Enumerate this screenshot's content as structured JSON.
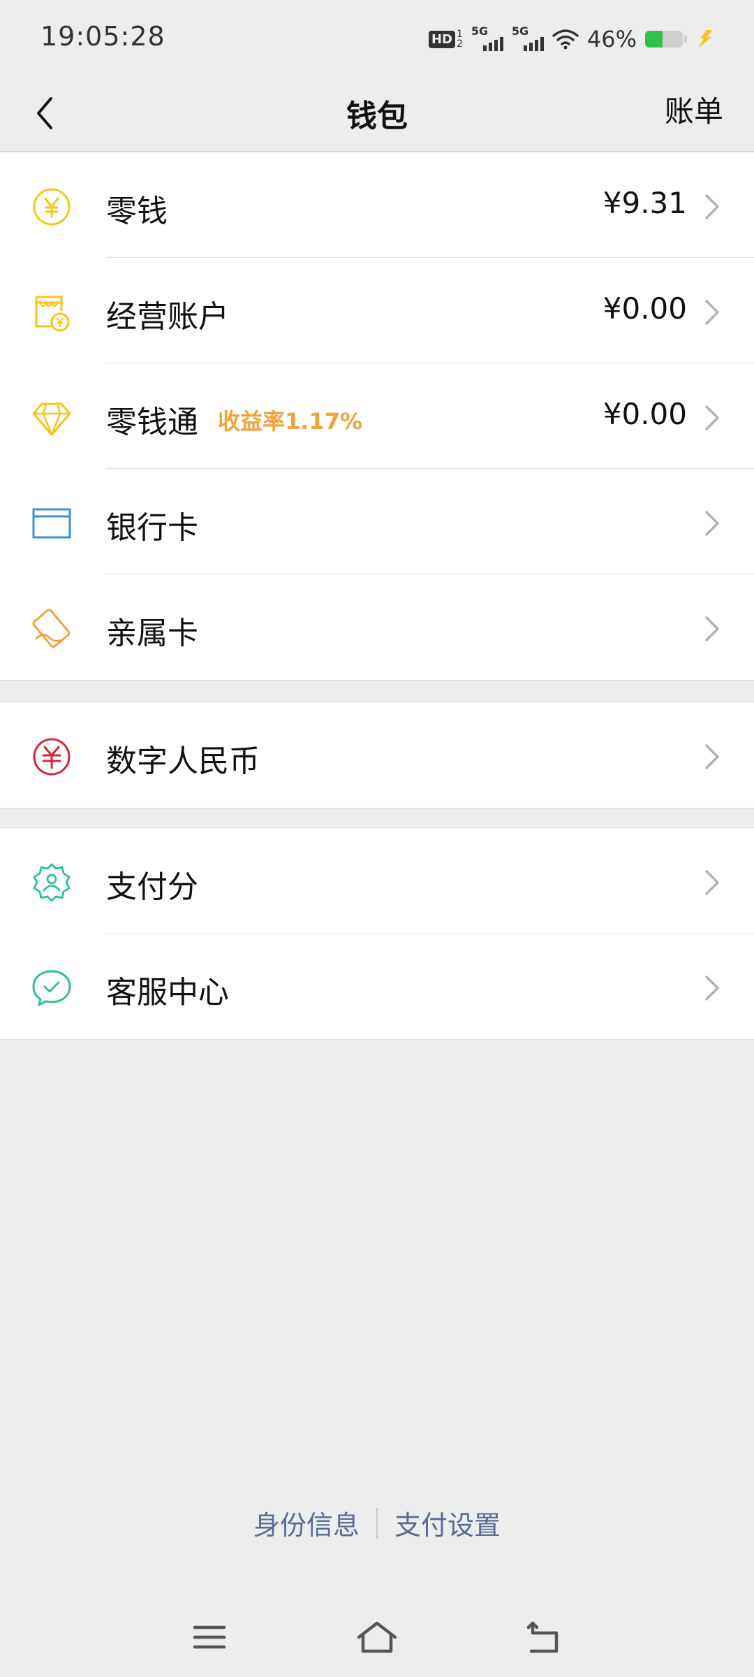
{
  "status_bar": {
    "time": "19:05:28",
    "hd_label": "HD",
    "hd_top": "1",
    "hd_bottom": "2",
    "sim1_label": "5G",
    "sim2_label": "5G",
    "battery_percent": "46%",
    "battery_level": 0.46
  },
  "header": {
    "title": "钱包",
    "action": "账单"
  },
  "groups": [
    {
      "items": [
        {
          "label": "零钱",
          "value": "¥9.31",
          "icon": "yuan-coin-icon",
          "color": "#f5c518"
        },
        {
          "label": "经营账户",
          "value": "¥0.00",
          "icon": "shop-account-icon",
          "color": "#f5c518"
        },
        {
          "label": "零钱通",
          "badge": "收益率1.17%",
          "value": "¥0.00",
          "icon": "diamond-icon",
          "color": "#f5c518"
        },
        {
          "label": "银行卡",
          "icon": "bank-card-icon",
          "color": "#3d8fd9"
        },
        {
          "label": "亲属卡",
          "icon": "family-card-icon",
          "color": "#f0a33a"
        }
      ]
    },
    {
      "items": [
        {
          "label": "数字人民币",
          "icon": "digital-rmb-icon",
          "color": "#d8243c"
        }
      ]
    },
    {
      "items": [
        {
          "label": "支付分",
          "icon": "pay-score-icon",
          "color": "#2fc289"
        },
        {
          "label": "客服中心",
          "icon": "customer-service-icon",
          "color": "#2fc289"
        }
      ]
    }
  ],
  "footer": {
    "identity": "身份信息",
    "payment_settings": "支付设置"
  }
}
